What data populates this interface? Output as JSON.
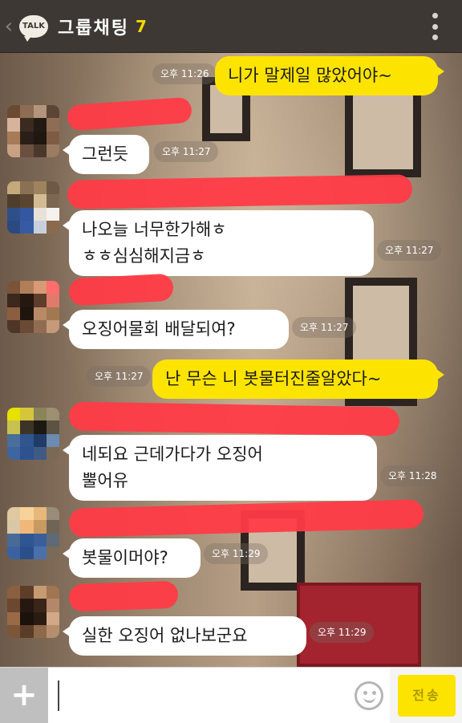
{
  "header": {
    "back_icon": "chevron-left-icon",
    "logo": "TALK",
    "title": "그룹채팅",
    "member_count": "7",
    "menu_icon": "more-vertical-icon"
  },
  "messages": [
    {
      "type": "mine",
      "text": "니가 말제일 많았어야~",
      "time": "오후 11:26"
    },
    {
      "type": "theirs",
      "text": "그런듯",
      "time": "오후 11:27"
    },
    {
      "type": "theirs",
      "text": "나오늘 너무한가해ㅎ\nㅎㅎ심심해지금ㅎ",
      "time": "오후 11:27"
    },
    {
      "type": "theirs",
      "text": "오징어물회 배달되여?",
      "time": "오후 11:27"
    },
    {
      "type": "mine",
      "text": "난 무슨 니 봇물터진줄알았다~",
      "time": "오후 11:27"
    },
    {
      "type": "theirs",
      "text": "네되요 근데가다가 오징어\n뿔어유",
      "time": "오후 11:28"
    },
    {
      "type": "theirs",
      "text": "봇물이머야?",
      "time": "오후 11:29"
    },
    {
      "type": "theirs",
      "text": "실한 오징어 없나보군요",
      "time": "오후 11:29"
    }
  ],
  "footer": {
    "plus_icon": "plus-icon",
    "input_value": "",
    "emoji_icon": "emoticon-icon",
    "send_label": "전송"
  },
  "colors": {
    "mine_bubble": "#fde400",
    "theirs_bubble": "#ffffff",
    "header_bg": "#3d3833",
    "redaction": "#ff3b47"
  }
}
